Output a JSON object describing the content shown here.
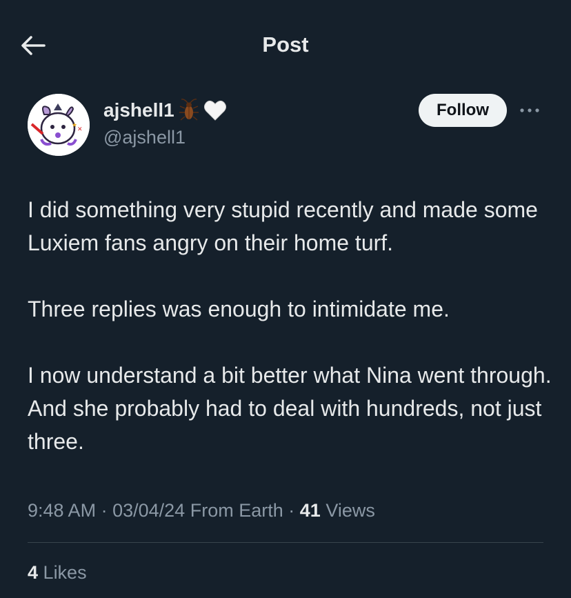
{
  "header": {
    "title": "Post"
  },
  "author": {
    "display_name": "ajshell1",
    "handle": "@ajshell1",
    "name_emojis": [
      "cockroach-icon",
      "white-heart-icon"
    ]
  },
  "actions": {
    "follow_label": "Follow"
  },
  "tweet": {
    "paragraphs": [
      "I did something very stupid recently and made some Luxiem fans angry on their home turf.",
      "Three replies was enough to intimidate me.",
      "I now understand a bit better what Nina went through. And she probably had to deal with hundreds, not just three."
    ]
  },
  "meta": {
    "time": "9:48 AM",
    "separator": "·",
    "date": "03/04/24",
    "source": "From Earth",
    "views_count": "41",
    "views_label": "Views"
  },
  "stats": {
    "likes_count": "4",
    "likes_label": "Likes"
  },
  "colors": {
    "background": "#15202b",
    "text_primary": "#e7e9ea",
    "text_secondary": "#8b98a5",
    "follow_bg": "#eff3f4",
    "divider": "#38444d"
  }
}
